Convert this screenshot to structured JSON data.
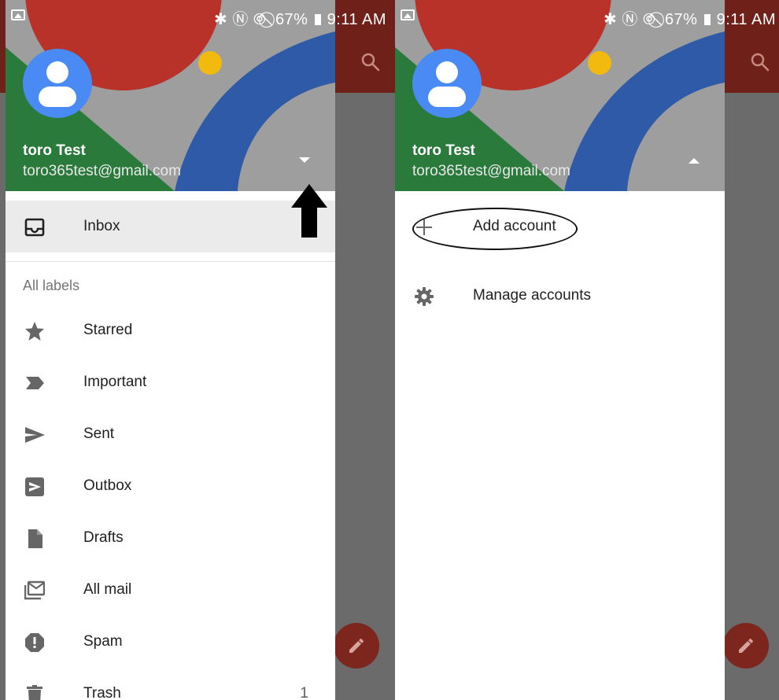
{
  "status_bar": {
    "system_icons": "✱ Ⓝ ⦾ ⃠",
    "battery": "67%",
    "time": "9:11 AM"
  },
  "left_screen": {
    "account": {
      "name": "toro Test",
      "email": "toro365test@gmail.com",
      "toggle_icon": "caret-down-icon"
    },
    "inbox_label": "Inbox",
    "section_label": "All labels",
    "labels": [
      {
        "label": "Starred",
        "icon": "star-icon",
        "count": ""
      },
      {
        "label": "Important",
        "icon": "important-icon",
        "count": ""
      },
      {
        "label": "Sent",
        "icon": "send-icon",
        "count": ""
      },
      {
        "label": "Outbox",
        "icon": "outbox-icon",
        "count": ""
      },
      {
        "label": "Drafts",
        "icon": "draft-icon",
        "count": ""
      },
      {
        "label": "All mail",
        "icon": "all-mail-icon",
        "count": ""
      },
      {
        "label": "Spam",
        "icon": "spam-icon",
        "count": ""
      },
      {
        "label": "Trash",
        "icon": "trash-icon",
        "count": "1"
      }
    ],
    "annotation": "up-arrow-pointer"
  },
  "right_screen": {
    "account": {
      "name": "toro Test",
      "email": "toro365test@gmail.com",
      "toggle_icon": "caret-up-icon"
    },
    "add_account_label": "Add account",
    "manage_accounts_label": "Manage accounts",
    "annotation": "highlight-oval"
  },
  "colors": {
    "header_red": "#b8322a",
    "header_blue": "#2f5aa8",
    "header_green": "#2a7a3c",
    "header_yellow": "#f2b90f",
    "avatar_blue": "#4a8af4",
    "backdrop_gray": "#6b6b6b",
    "backdrop_appbar": "#6e2019",
    "active_row": "#ebebeb"
  }
}
